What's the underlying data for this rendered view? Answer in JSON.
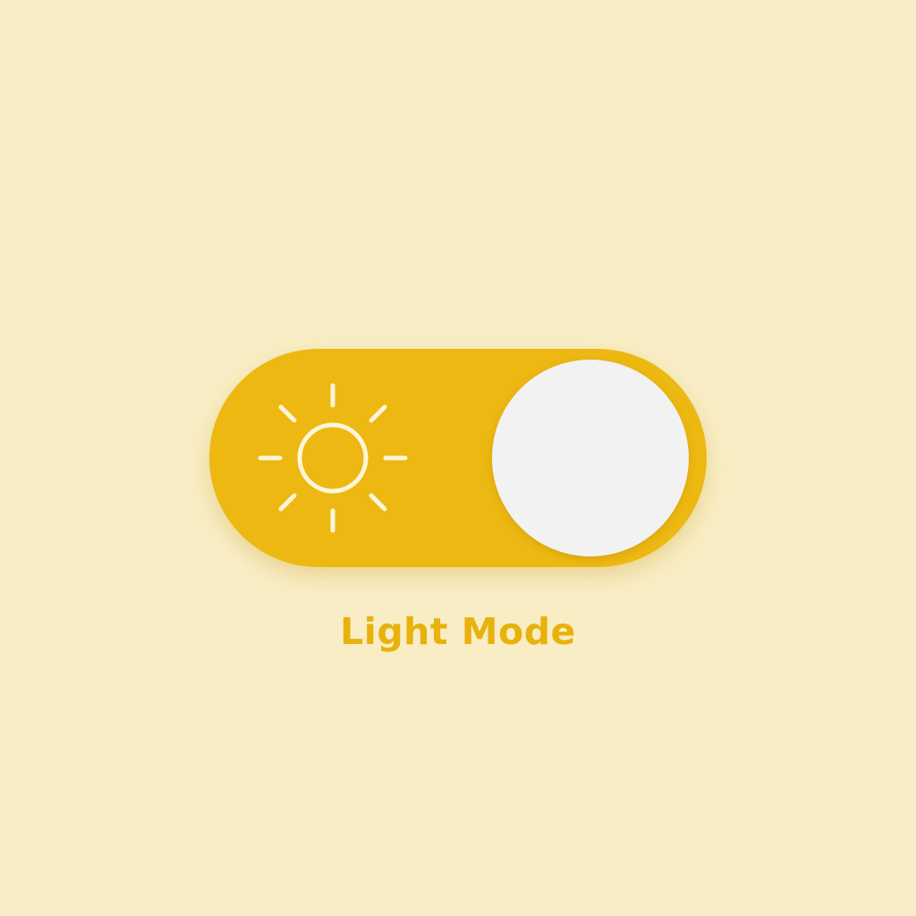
{
  "toggle": {
    "label": "Light Mode",
    "state": "on",
    "icon": "sun-icon",
    "colors": {
      "background": "#f8edc4",
      "track": "#edb812",
      "knob": "#f2f2f2",
      "icon": "#fff5d9",
      "label": "#e9b10c"
    }
  }
}
